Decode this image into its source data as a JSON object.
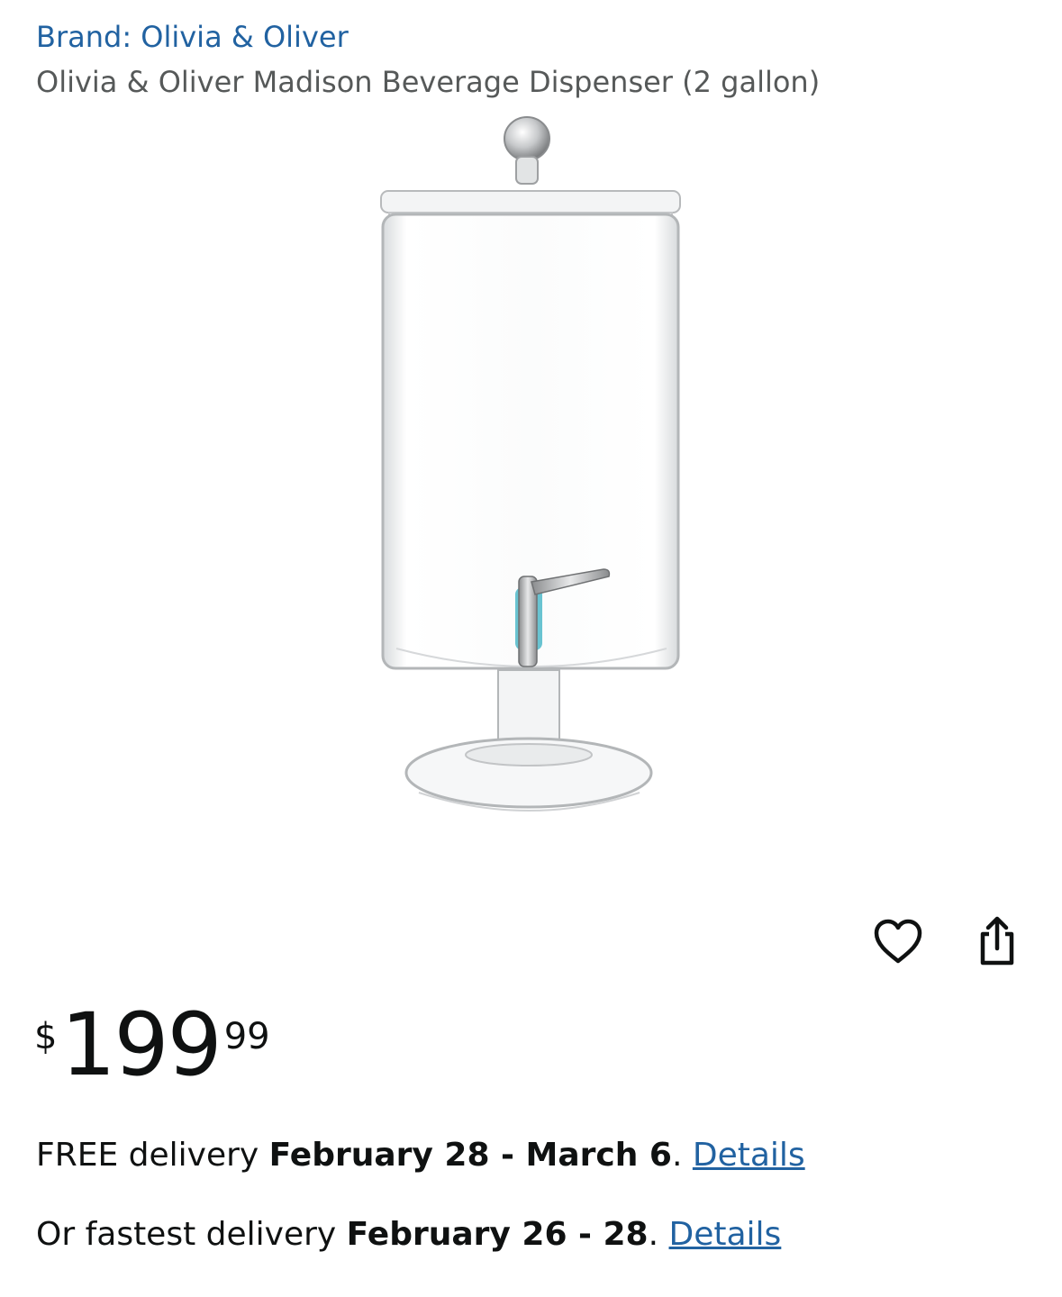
{
  "brand_link": "Brand: Olivia & Oliver",
  "product_title": "Olivia & Oliver Madison Beverage Dispenser (2 gallon)",
  "icons": {
    "favorite": "heart-icon",
    "share": "share-icon"
  },
  "price": {
    "symbol": "$",
    "whole": "199",
    "fraction": "99"
  },
  "delivery": {
    "free_prefix": "FREE delivery ",
    "free_dates": "February 28 - March 6",
    "free_period": ". ",
    "free_details": "Details",
    "fast_prefix": "Or fastest delivery ",
    "fast_dates": "February 26 - 28",
    "fast_period": ". ",
    "fast_details": "Details"
  },
  "colors": {
    "link": "#2162a1",
    "text": "#0f1111",
    "secondary_text": "#565959",
    "tap_accent": "#4fb9c9"
  }
}
